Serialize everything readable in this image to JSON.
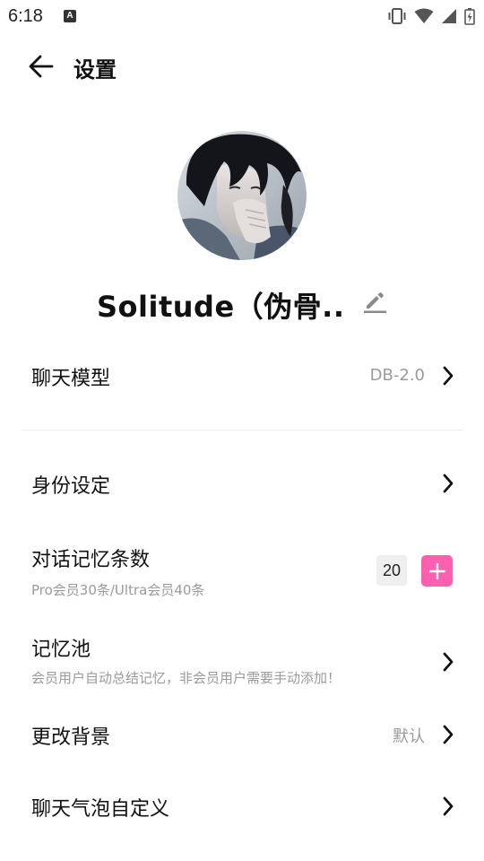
{
  "status_bar": {
    "time": "6:18",
    "notification_letter": "A",
    "icons": [
      "vibrate-icon",
      "wifi-icon",
      "signal-icon",
      "battery-charging-icon"
    ]
  },
  "header": {
    "title": "设置",
    "back_icon": "arrow-left-icon"
  },
  "profile": {
    "name": "Solitude（伪骨..",
    "edit_icon": "pencil-icon"
  },
  "settings": {
    "chat_model": {
      "label": "聊天模型",
      "value": "DB-2.0"
    },
    "identity": {
      "label": "身份设定"
    },
    "memory_count": {
      "label": "对话记忆条数",
      "subtitle": "Pro会员30条/Ultra会员40条",
      "value": "20"
    },
    "memory_pool": {
      "label": "记忆池",
      "subtitle": "会员用户自动总结记忆，非会员用户需要手动添加！"
    },
    "background": {
      "label": "更改背景",
      "value": "默认"
    },
    "bubble": {
      "label": "聊天气泡自定义"
    }
  },
  "colors": {
    "accent": "#ff5fae",
    "text_primary": "#111111",
    "text_secondary": "#9a9a9a"
  }
}
